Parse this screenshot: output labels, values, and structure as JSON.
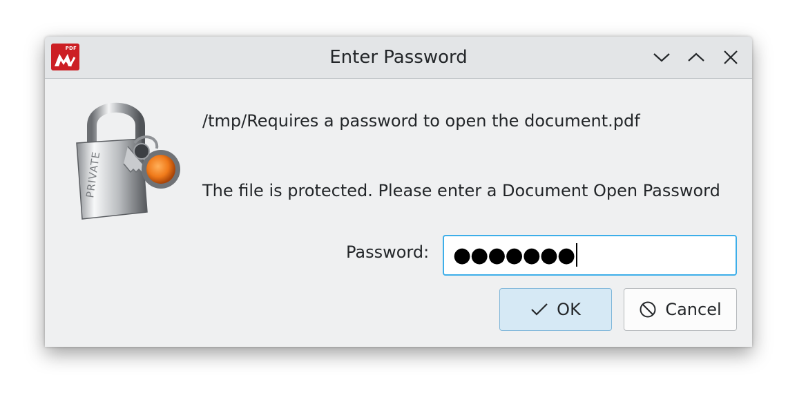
{
  "window": {
    "title": "Enter Password",
    "app_icon_label": "PDF"
  },
  "dialog": {
    "file_path": "/tmp/Requires a password to open the document.pdf",
    "message": "The file is protected. Please enter a Document Open Password",
    "password_label": "Password:",
    "password_masked": "●●●●●●●"
  },
  "buttons": {
    "ok_label": "OK",
    "cancel_label": "Cancel"
  },
  "icons": {
    "app": "pdf-app-icon",
    "minimize": "chevron-down-icon",
    "maximize": "chevron-up-icon",
    "close": "close-icon",
    "dialog": "padlock-icon",
    "ok": "checkmark-icon",
    "cancel": "cancel-icon"
  },
  "colors": {
    "focus_accent": "#3daee9",
    "app_brand": "#cc1f24",
    "default_button_bg": "#d6e9f5"
  }
}
